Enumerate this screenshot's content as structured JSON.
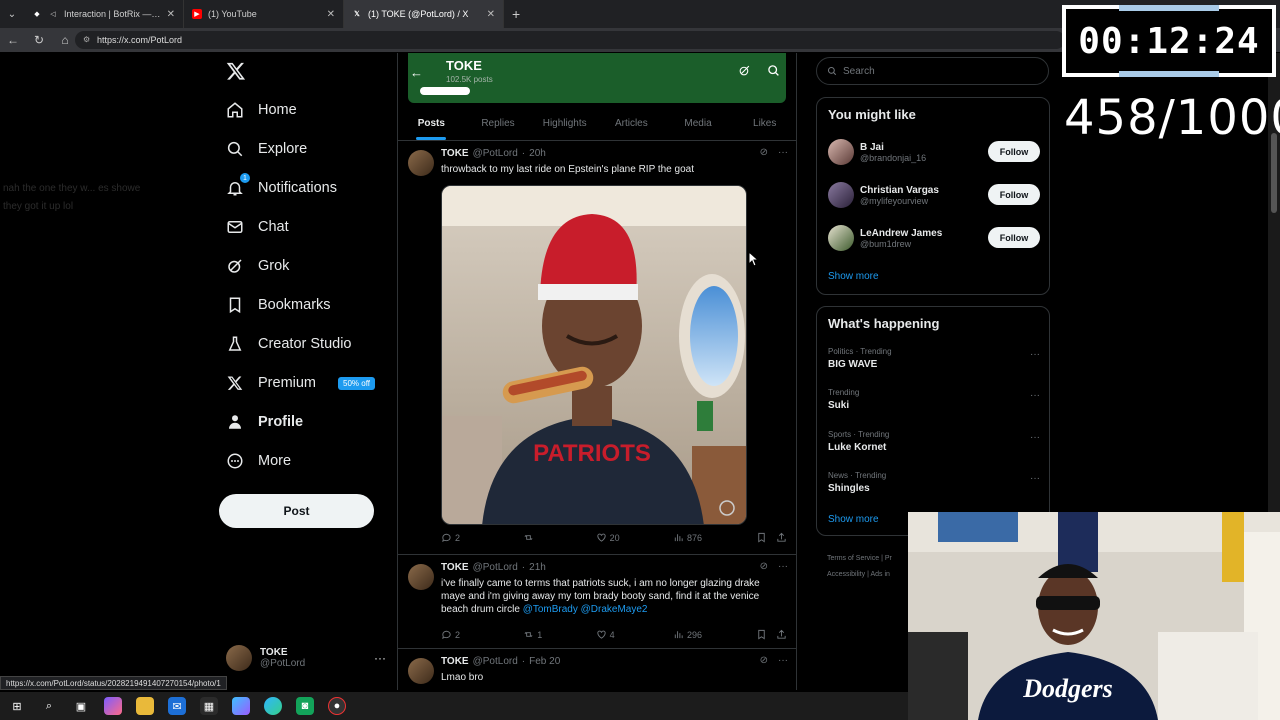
{
  "browser": {
    "tabs": [
      {
        "title": "Interaction | BotRix — Cloud S",
        "icon": "botrix-icon",
        "active": false
      },
      {
        "title": "(1) YouTube",
        "icon": "youtube-icon",
        "active": false
      },
      {
        "title": "(1) TOKE (@PotLord) / X",
        "icon": "x-icon",
        "active": true
      }
    ],
    "url": "https://x.com/PotLord",
    "status_url": "https://x.com/PotLord/status/2028219491407270154/photo/1"
  },
  "nav": {
    "items": [
      {
        "label": "Home",
        "icon": "home-icon"
      },
      {
        "label": "Explore",
        "icon": "search-icon"
      },
      {
        "label": "Notifications",
        "icon": "bell-icon",
        "badge": "1"
      },
      {
        "label": "Chat",
        "icon": "mail-icon"
      },
      {
        "label": "Grok",
        "icon": "grok-icon"
      },
      {
        "label": "Bookmarks",
        "icon": "bookmark-icon"
      },
      {
        "label": "Creator Studio",
        "icon": "flask-icon"
      },
      {
        "label": "Premium",
        "icon": "x-icon",
        "badge": "50% off"
      },
      {
        "label": "Profile",
        "icon": "person-icon"
      },
      {
        "label": "More",
        "icon": "more-circle-icon"
      }
    ],
    "post_label": "Post",
    "account": {
      "name": "TOKE",
      "handle": "@PotLord"
    }
  },
  "ghost_chat": {
    "line1": "nah the one they w... es showe",
    "line2": "they got it up lol"
  },
  "profile_header": {
    "title": "TOKE",
    "subtitle": "102.5K posts"
  },
  "tabs": [
    "Posts",
    "Replies",
    "Highlights",
    "Articles",
    "Media",
    "Likes"
  ],
  "posts": [
    {
      "name": "TOKE",
      "handle": "@PotLord",
      "time": "20h",
      "text": "throwback to my last ride on Epstein's plane RIP the goat",
      "stats": {
        "replies": "2",
        "reposts": "",
        "likes": "20",
        "views": "876"
      }
    },
    {
      "name": "TOKE",
      "handle": "@PotLord",
      "time": "21h",
      "text": "i've finally came to terms that patriots suck, i am no longer glazing drake maye and i'm giving away my tom brady booty sand, find it at the venice beach drum circle ",
      "mentions": "@TomBrady @DrakeMaye2",
      "stats": {
        "replies": "2",
        "reposts": "1",
        "likes": "4",
        "views": "296"
      }
    },
    {
      "name": "TOKE",
      "handle": "@PotLord",
      "time": "Feb 20",
      "text": "Lmao bro"
    }
  ],
  "right": {
    "search_placeholder": "Search",
    "you_might_like": {
      "title": "You might like",
      "users": [
        {
          "name": "B Jai",
          "handle": "@brandonjai_16",
          "button": "Follow"
        },
        {
          "name": "Christian Vargas",
          "handle": "@mylifeyourview",
          "button": "Follow"
        },
        {
          "name": "LeAndrew James",
          "handle": "@bum1drew",
          "button": "Follow"
        }
      ],
      "show_more": "Show more"
    },
    "happening": {
      "title": "What's happening",
      "trends": [
        {
          "meta": "Politics · Trending",
          "name": "BIG WAVE"
        },
        {
          "meta": "Trending",
          "name": "Suki"
        },
        {
          "meta": "Sports · Trending",
          "name": "Luke Kornet"
        },
        {
          "meta": "News · Trending",
          "name": "Shingles"
        }
      ],
      "show_more": "Show more"
    },
    "footer": {
      "line1": "Terms of Service  |  Pr",
      "line2": "Accessibility  |  Ads in"
    }
  },
  "overlay": {
    "timer": "00:12:24",
    "counter": "458/1000"
  }
}
